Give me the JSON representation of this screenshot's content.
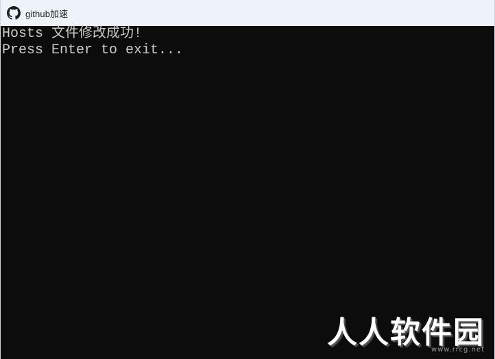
{
  "window": {
    "title": "github加速",
    "icon": "github-icon"
  },
  "console": {
    "lines": [
      "Hosts 文件修改成功!",
      "Press Enter to exit..."
    ],
    "background": "#0c0c0c",
    "text_color": "#cccccc"
  },
  "watermark": {
    "text": "人人软件园",
    "sub": "www.rrcg.net"
  }
}
